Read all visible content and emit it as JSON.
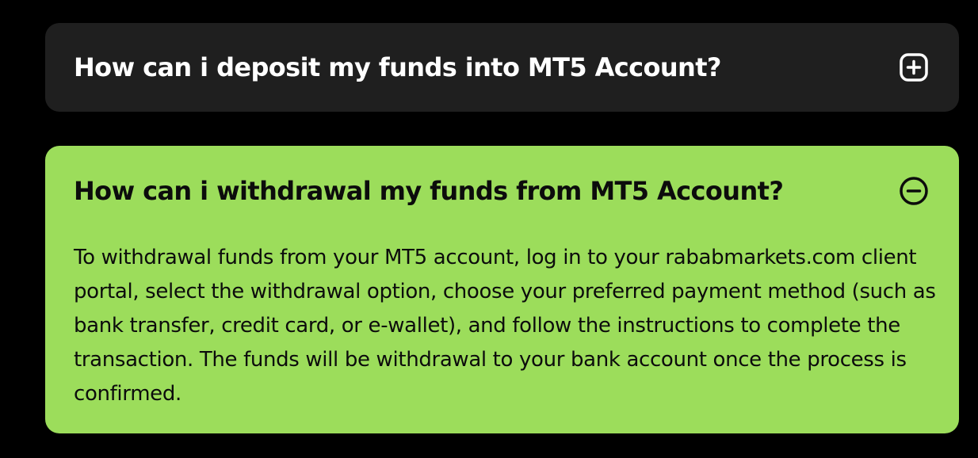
{
  "faq": {
    "items": [
      {
        "question": "How can i deposit my funds into MT5 Account?",
        "expanded": false,
        "toggle_icon": "plus-square-icon"
      },
      {
        "question": "How can i withdrawal my funds from MT5 Account?",
        "expanded": true,
        "toggle_icon": "minus-circle-icon",
        "answer": "To withdrawal funds from your MT5 account, log in to your rababmarkets.com client portal, select the withdrawal option, choose your preferred payment method (such as bank transfer, credit card, or e-wallet), and follow the instructions to complete the transaction. The funds will be withdrawal to your bank account once the process is confirmed."
      }
    ]
  },
  "colors": {
    "background": "#000000",
    "collapsed_card": "#1f1f1f",
    "expanded_card": "#9cdd5b",
    "collapsed_text": "#ffffff",
    "expanded_text": "#0c0c0c"
  }
}
